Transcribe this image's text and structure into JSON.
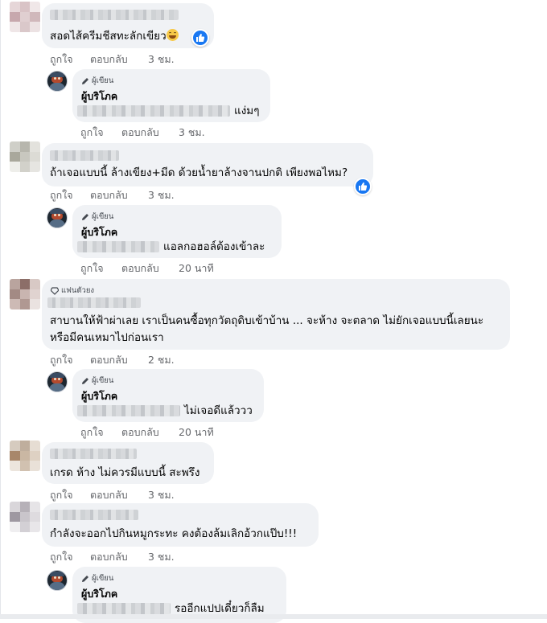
{
  "colors": {
    "bubble": "#f0f2f5",
    "action_text": "#65676b",
    "like_blue": "#1877f2"
  },
  "actions": {
    "like": "ถูกใจ",
    "reply": "ตอบกลับ"
  },
  "comments": [
    {
      "text": "สอดไส้ครีมชีสทะลักเขียว",
      "time": "3 ชม.",
      "has_like_reaction": true,
      "emoji": "grinning-face"
    },
    {
      "badge": "ผู้เขียน",
      "name": "ผู้บริโภค",
      "text": "แง่มๆ",
      "time": "3 ชม."
    },
    {
      "text": "ถ้าเจอแบบนี้ ล้างเขียง+มีด ด้วยน้ำยาล้างจานปกติ เพียงพอไหม?",
      "time": "3 ชม.",
      "has_like_reaction": true
    },
    {
      "badge": "ผู้เขียน",
      "name": "ผู้บริโภค",
      "text": "แอลกอฮอล์ต้องเข้าละ",
      "time": "20 นาที"
    },
    {
      "badge": "แฟนตัวยง",
      "text_line1": "สาบานให้ฟ้าผ่าเลย เราเป็นคนซื้อทุกวัตถุดิบเข้าบ้าน ... จะห้าง จะตลาด ไม่ยักเจอแบบนี้เลยนะ",
      "text_line2": "หรือมีคนเหมาไปก่อนเรา",
      "time": "2 ชม."
    },
    {
      "badge": "ผู้เขียน",
      "name": "ผู้บริโภค",
      "text": "ไม่เจอดีแล้ววว",
      "time": "20 นาที"
    },
    {
      "text": "เกรด ห้าง ไม่ควรมีแบบนี้ สะพรึง",
      "time": "3 ชม."
    },
    {
      "text": "กำลังจะออกไปกินหมูกระทะ คงต้องล้มเลิกอ้วกแป๊บ!!!",
      "time": "3 ชม."
    },
    {
      "badge": "ผู้เขียน",
      "name": "ผู้บริโภค",
      "text": "รออีกแปปเดี๋ยวก็ลืม"
    }
  ]
}
